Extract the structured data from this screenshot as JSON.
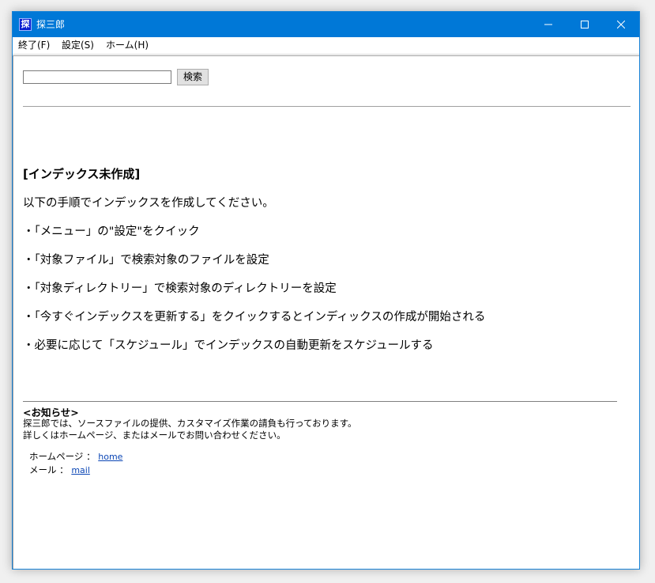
{
  "window": {
    "app_icon_glyph": "探",
    "title": "探三郎",
    "controls": [
      "minimize",
      "maximize",
      "close"
    ]
  },
  "menu": [
    {
      "label": "終了(F)"
    },
    {
      "label": "設定(S)"
    },
    {
      "label": "ホーム(H)"
    }
  ],
  "search": {
    "value": "",
    "button_label": "検索"
  },
  "main": {
    "heading": "[インデックス未作成]",
    "intro": "以下の手順でインデックスを作成してください。",
    "steps": [
      "・「メニュー」の\"設定\"をクイック",
      "・「対象ファイル」で検索対象のファイルを設定",
      "・「対象ディレクトリー」で検索対象のディレクトリーを設定",
      "・「今すぐインデックスを更新する」をクイックするとインディックスの作成が開始される",
      "・必要に応じて「スケジュール」でインデックスの自動更新をスケジュールする"
    ]
  },
  "notice": {
    "title": "<お知らせ>",
    "line1": "探三郎では、ソースファイルの提供、カスタマイズ作業の請負も行っております。",
    "line2": "詳しくはホームページ、またはメールでお問い合わせください。",
    "homepage_label": "ホームページ ：",
    "homepage_link": "home",
    "mail_label": "メール ：",
    "mail_link": "mail"
  },
  "colors": {
    "titlebar": "#0078d7",
    "link": "#0b46b5"
  }
}
